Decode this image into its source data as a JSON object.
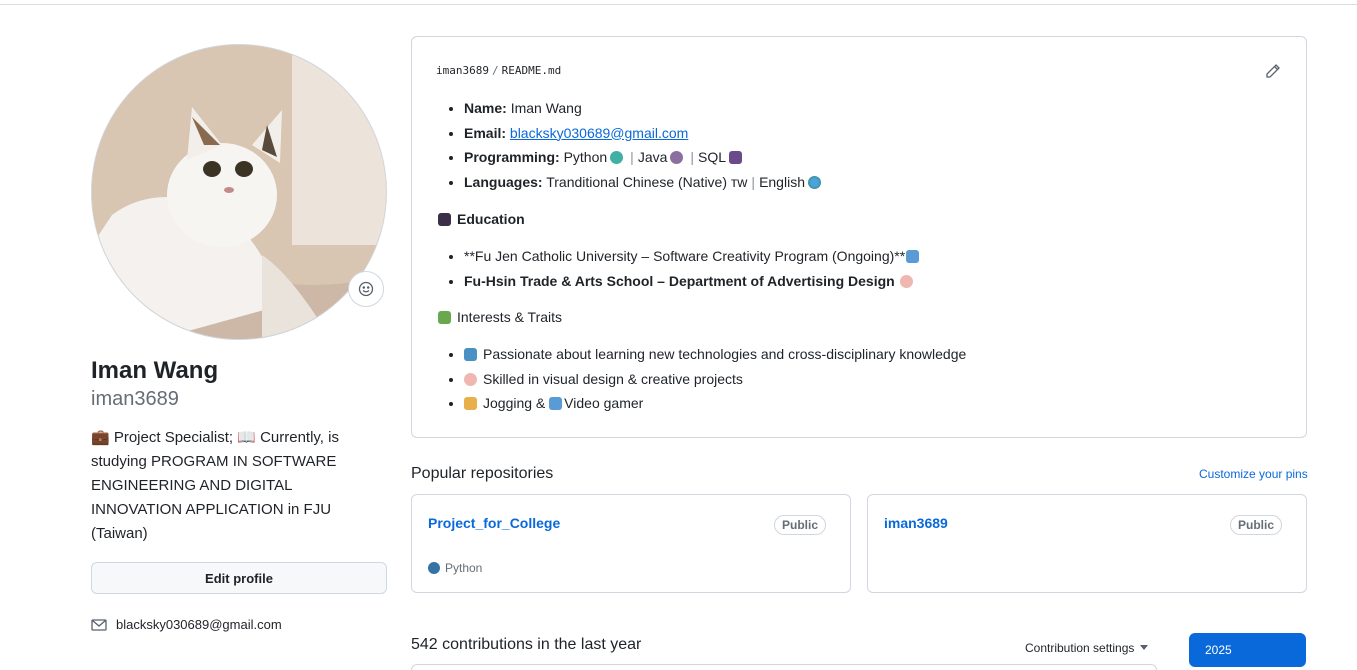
{
  "profile": {
    "full_name": "Iman Wang",
    "username": "iman3689",
    "bio": "💼 Project Specialist; 📖 Currently, is studying PROGRAM IN SOFTWARE ENGINEERING AND DIGITAL INNOVATION APPLICATION in FJU (Taiwan)",
    "edit_label": "Edit profile",
    "email": "blacksky030689@gmail.com",
    "avatar_icon": "cat-photo-avatar",
    "status_icon": "smiley-icon"
  },
  "readme": {
    "owner": "iman3689",
    "separator": "/",
    "file": "README.md",
    "info": [
      {
        "label": "Name:",
        "value": "Iman Wang"
      },
      {
        "label": "Email:",
        "value": "blacksky030689@gmail.com"
      },
      {
        "label": "Programming:",
        "value": "Python",
        "v2": "Java",
        "v3": "SQL"
      },
      {
        "label": "Languages:",
        "value": "Tranditional Chinese (Native) ᴛᴡ",
        "v2": "English"
      }
    ],
    "education_title": "Education",
    "education": [
      "**Fu Jen Catholic University – Software Creativity Program (Ongoing)**",
      "Fu-Hsin Trade & Arts School – Department of Advertising Design"
    ],
    "interests_title": "Interests & Traits",
    "interests": [
      "Passionate about learning new technologies and cross-disciplinary knowledge",
      "Skilled in visual design & creative projects",
      "Jogging & ",
      "Video gamer"
    ]
  },
  "popular": {
    "title": "Popular repositories",
    "customize": "Customize your pins",
    "repos": [
      {
        "name": "Project_for_College",
        "visibility": "Public",
        "language": "Python",
        "lang_color": "#3572A5"
      },
      {
        "name": "iman3689",
        "visibility": "Public"
      }
    ]
  },
  "contributions": {
    "summary": "542 contributions in the last year",
    "settings": "Contribution settings",
    "year": "2025"
  }
}
